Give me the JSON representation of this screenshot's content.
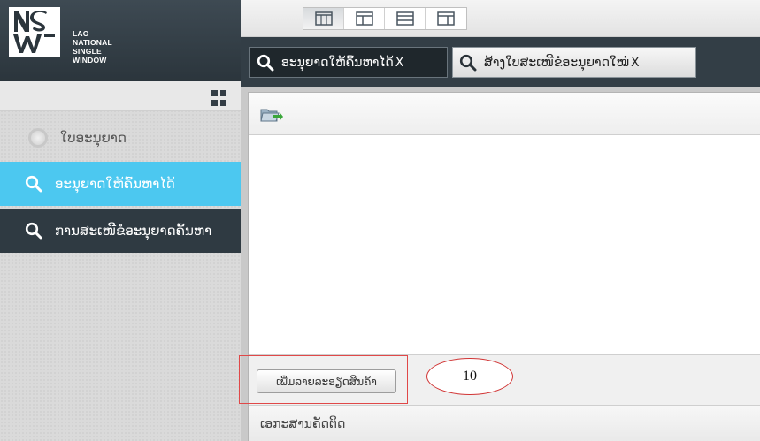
{
  "brand": {
    "logo_text": "NSW",
    "line1": "LAO",
    "line2": "NATIONAL",
    "line3": "SINGLE",
    "line4": "WINDOW"
  },
  "sidebar": {
    "header_label": "ໃບອະນຸຍາດ",
    "items": [
      {
        "label": "ອະນຸຍາດໃຫ້ຄົ້ນຫາໄດ້",
        "active": true,
        "icon": "search-icon"
      },
      {
        "label": "ການສະເໜີຂໍອະນຸຍາດຄົ້ນຫາ",
        "active": false,
        "icon": "search-icon"
      }
    ]
  },
  "toolbar": {
    "layout_buttons": [
      "layout-columns-icon",
      "layout-left-panel-icon",
      "layout-rows-icon",
      "layout-top-panel-icon"
    ]
  },
  "tabs": [
    {
      "label": "ອະນຸຍາດໃຫ້ຄົ້ນຫາໄດ້",
      "close": "X",
      "active": true
    },
    {
      "label": "ສ້າງໃບສະເໜີຂໍອະນຸຍາດໃໝ່",
      "close": "X",
      "active": false
    }
  ],
  "main": {
    "add_item_button": "ເພີ່ມລາຍລະອຽດສິນຄ້າ",
    "step_marker": "10",
    "attached_docs_label": "ເອກະສານຄັດຕິດ"
  },
  "colors": {
    "sidebar_dark": "#2f3a42",
    "active_item": "#4cc8f0",
    "annotation_red": "#d13434"
  }
}
